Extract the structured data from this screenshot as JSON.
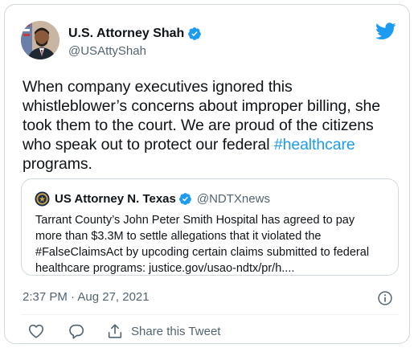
{
  "author": {
    "display_name": "U.S. Attorney Shah",
    "handle": "@USAttyShah"
  },
  "tweet": {
    "text_line_1": "When company executives ignored this",
    "text_line_2": "whistleblower’s concerns about improper billing, she",
    "text_line_3": "took them to the court. We are proud of the citizens",
    "text_line_4_before": "who speak out to protect our federal ",
    "hashtag": "#healthcare",
    "text_line_5": "programs."
  },
  "quote": {
    "display_name": "US Attorney N. Texas",
    "handle": "@NDTXnews",
    "line_1": "Tarrant County’s John Peter Smith Hospital has agreed to pay",
    "line_2": "more than $3.3M to settle allegations that it violated the",
    "line_3": "#FalseClaimsAct by upcoding certain claims submitted to federal",
    "line_4": "healthcare programs: justice.gov/usao-ndtx/pr/h...."
  },
  "timestamp": "2:37 PM · Aug 27, 2021",
  "actions": {
    "share_label": "Share this Tweet"
  },
  "colors": {
    "accent": "#1d9bf0",
    "text": "#0f1419",
    "muted": "#536471",
    "border": "#cfd9de"
  }
}
